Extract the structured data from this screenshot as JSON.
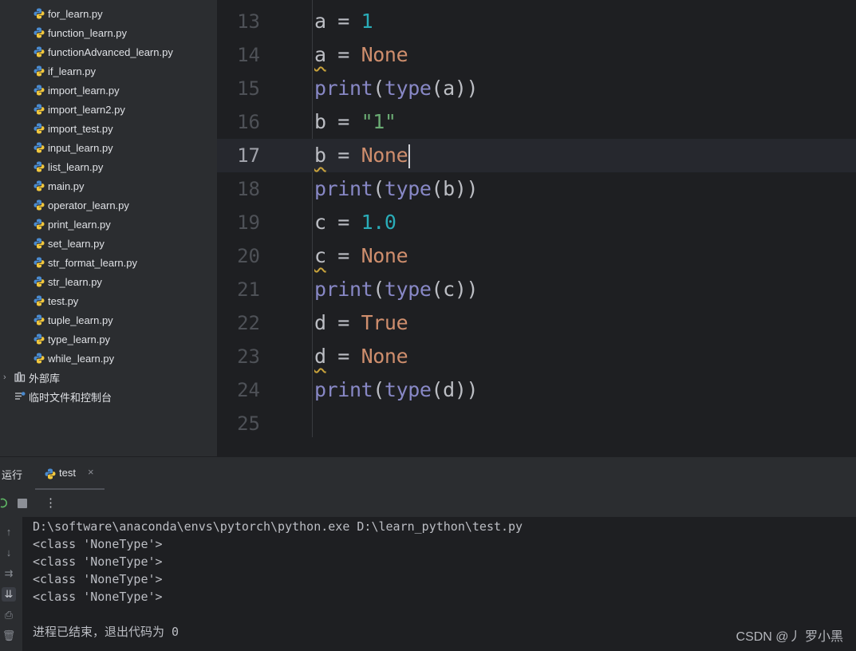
{
  "project_tree": {
    "files": [
      "for_learn.py",
      "function_learn.py",
      "functionAdvanced_learn.py",
      "if_learn.py",
      "import_learn.py",
      "import_learn2.py",
      "import_test.py",
      "input_learn.py",
      "list_learn.py",
      "main.py",
      "operator_learn.py",
      "print_learn.py",
      "set_learn.py",
      "str_format_learn.py",
      "str_learn.py",
      "test.py",
      "tuple_learn.py",
      "type_learn.py",
      "while_learn.py"
    ],
    "external_libs": "外部库",
    "scratches": "临时文件和控制台"
  },
  "editor": {
    "lines": [
      {
        "n": "13",
        "tokens": [
          [
            "v",
            "a"
          ],
          [
            "o",
            " = "
          ],
          [
            "num",
            "1"
          ]
        ]
      },
      {
        "n": "14",
        "tokens": [
          [
            "vw",
            "a"
          ],
          [
            "o",
            " = "
          ],
          [
            "kw",
            "None"
          ]
        ]
      },
      {
        "n": "15",
        "tokens": [
          [
            "fn",
            "print"
          ],
          [
            "o",
            "("
          ],
          [
            "fn",
            "type"
          ],
          [
            "o",
            "(a))"
          ]
        ]
      },
      {
        "n": "16",
        "tokens": [
          [
            "v",
            "b"
          ],
          [
            "o",
            " = "
          ],
          [
            "str",
            "\"1\""
          ]
        ]
      },
      {
        "n": "17",
        "tokens": [
          [
            "vw",
            "b"
          ],
          [
            "o",
            " = "
          ],
          [
            "kw",
            "None"
          ]
        ],
        "current": true
      },
      {
        "n": "18",
        "tokens": [
          [
            "fn",
            "print"
          ],
          [
            "o",
            "("
          ],
          [
            "fn",
            "type"
          ],
          [
            "o",
            "(b))"
          ]
        ]
      },
      {
        "n": "19",
        "tokens": [
          [
            "v",
            "c"
          ],
          [
            "o",
            " = "
          ],
          [
            "num",
            "1.0"
          ]
        ]
      },
      {
        "n": "20",
        "tokens": [
          [
            "vw",
            "c"
          ],
          [
            "o",
            " = "
          ],
          [
            "kw",
            "None"
          ]
        ]
      },
      {
        "n": "21",
        "tokens": [
          [
            "fn",
            "print"
          ],
          [
            "o",
            "("
          ],
          [
            "fn",
            "type"
          ],
          [
            "o",
            "(c))"
          ]
        ]
      },
      {
        "n": "22",
        "tokens": [
          [
            "v",
            "d"
          ],
          [
            "o",
            " = "
          ],
          [
            "kw",
            "True"
          ]
        ]
      },
      {
        "n": "23",
        "tokens": [
          [
            "vw",
            "d"
          ],
          [
            "o",
            " = "
          ],
          [
            "kw",
            "None"
          ]
        ]
      },
      {
        "n": "24",
        "tokens": [
          [
            "fn",
            "print"
          ],
          [
            "o",
            "("
          ],
          [
            "fn",
            "type"
          ],
          [
            "o",
            "(d))"
          ]
        ]
      },
      {
        "n": "25",
        "tokens": []
      }
    ]
  },
  "run_panel": {
    "title": "运行",
    "tab_label": "test",
    "close_glyph": "×",
    "menu_glyph": "⋮",
    "output": [
      "D:\\software\\anaconda\\envs\\pytorch\\python.exe D:\\learn_python\\test.py",
      "<class 'NoneType'>",
      "<class 'NoneType'>",
      "<class 'NoneType'>",
      "<class 'NoneType'>",
      "",
      "进程已结束，退出代码为 0"
    ]
  },
  "watermark": "CSDN @丿 罗小黑",
  "colors": {
    "number": "#2aacb8",
    "keyword": "#cf8e6d",
    "string": "#6aab73",
    "builtin": "#8888c6",
    "warning": "#c9a33b"
  }
}
